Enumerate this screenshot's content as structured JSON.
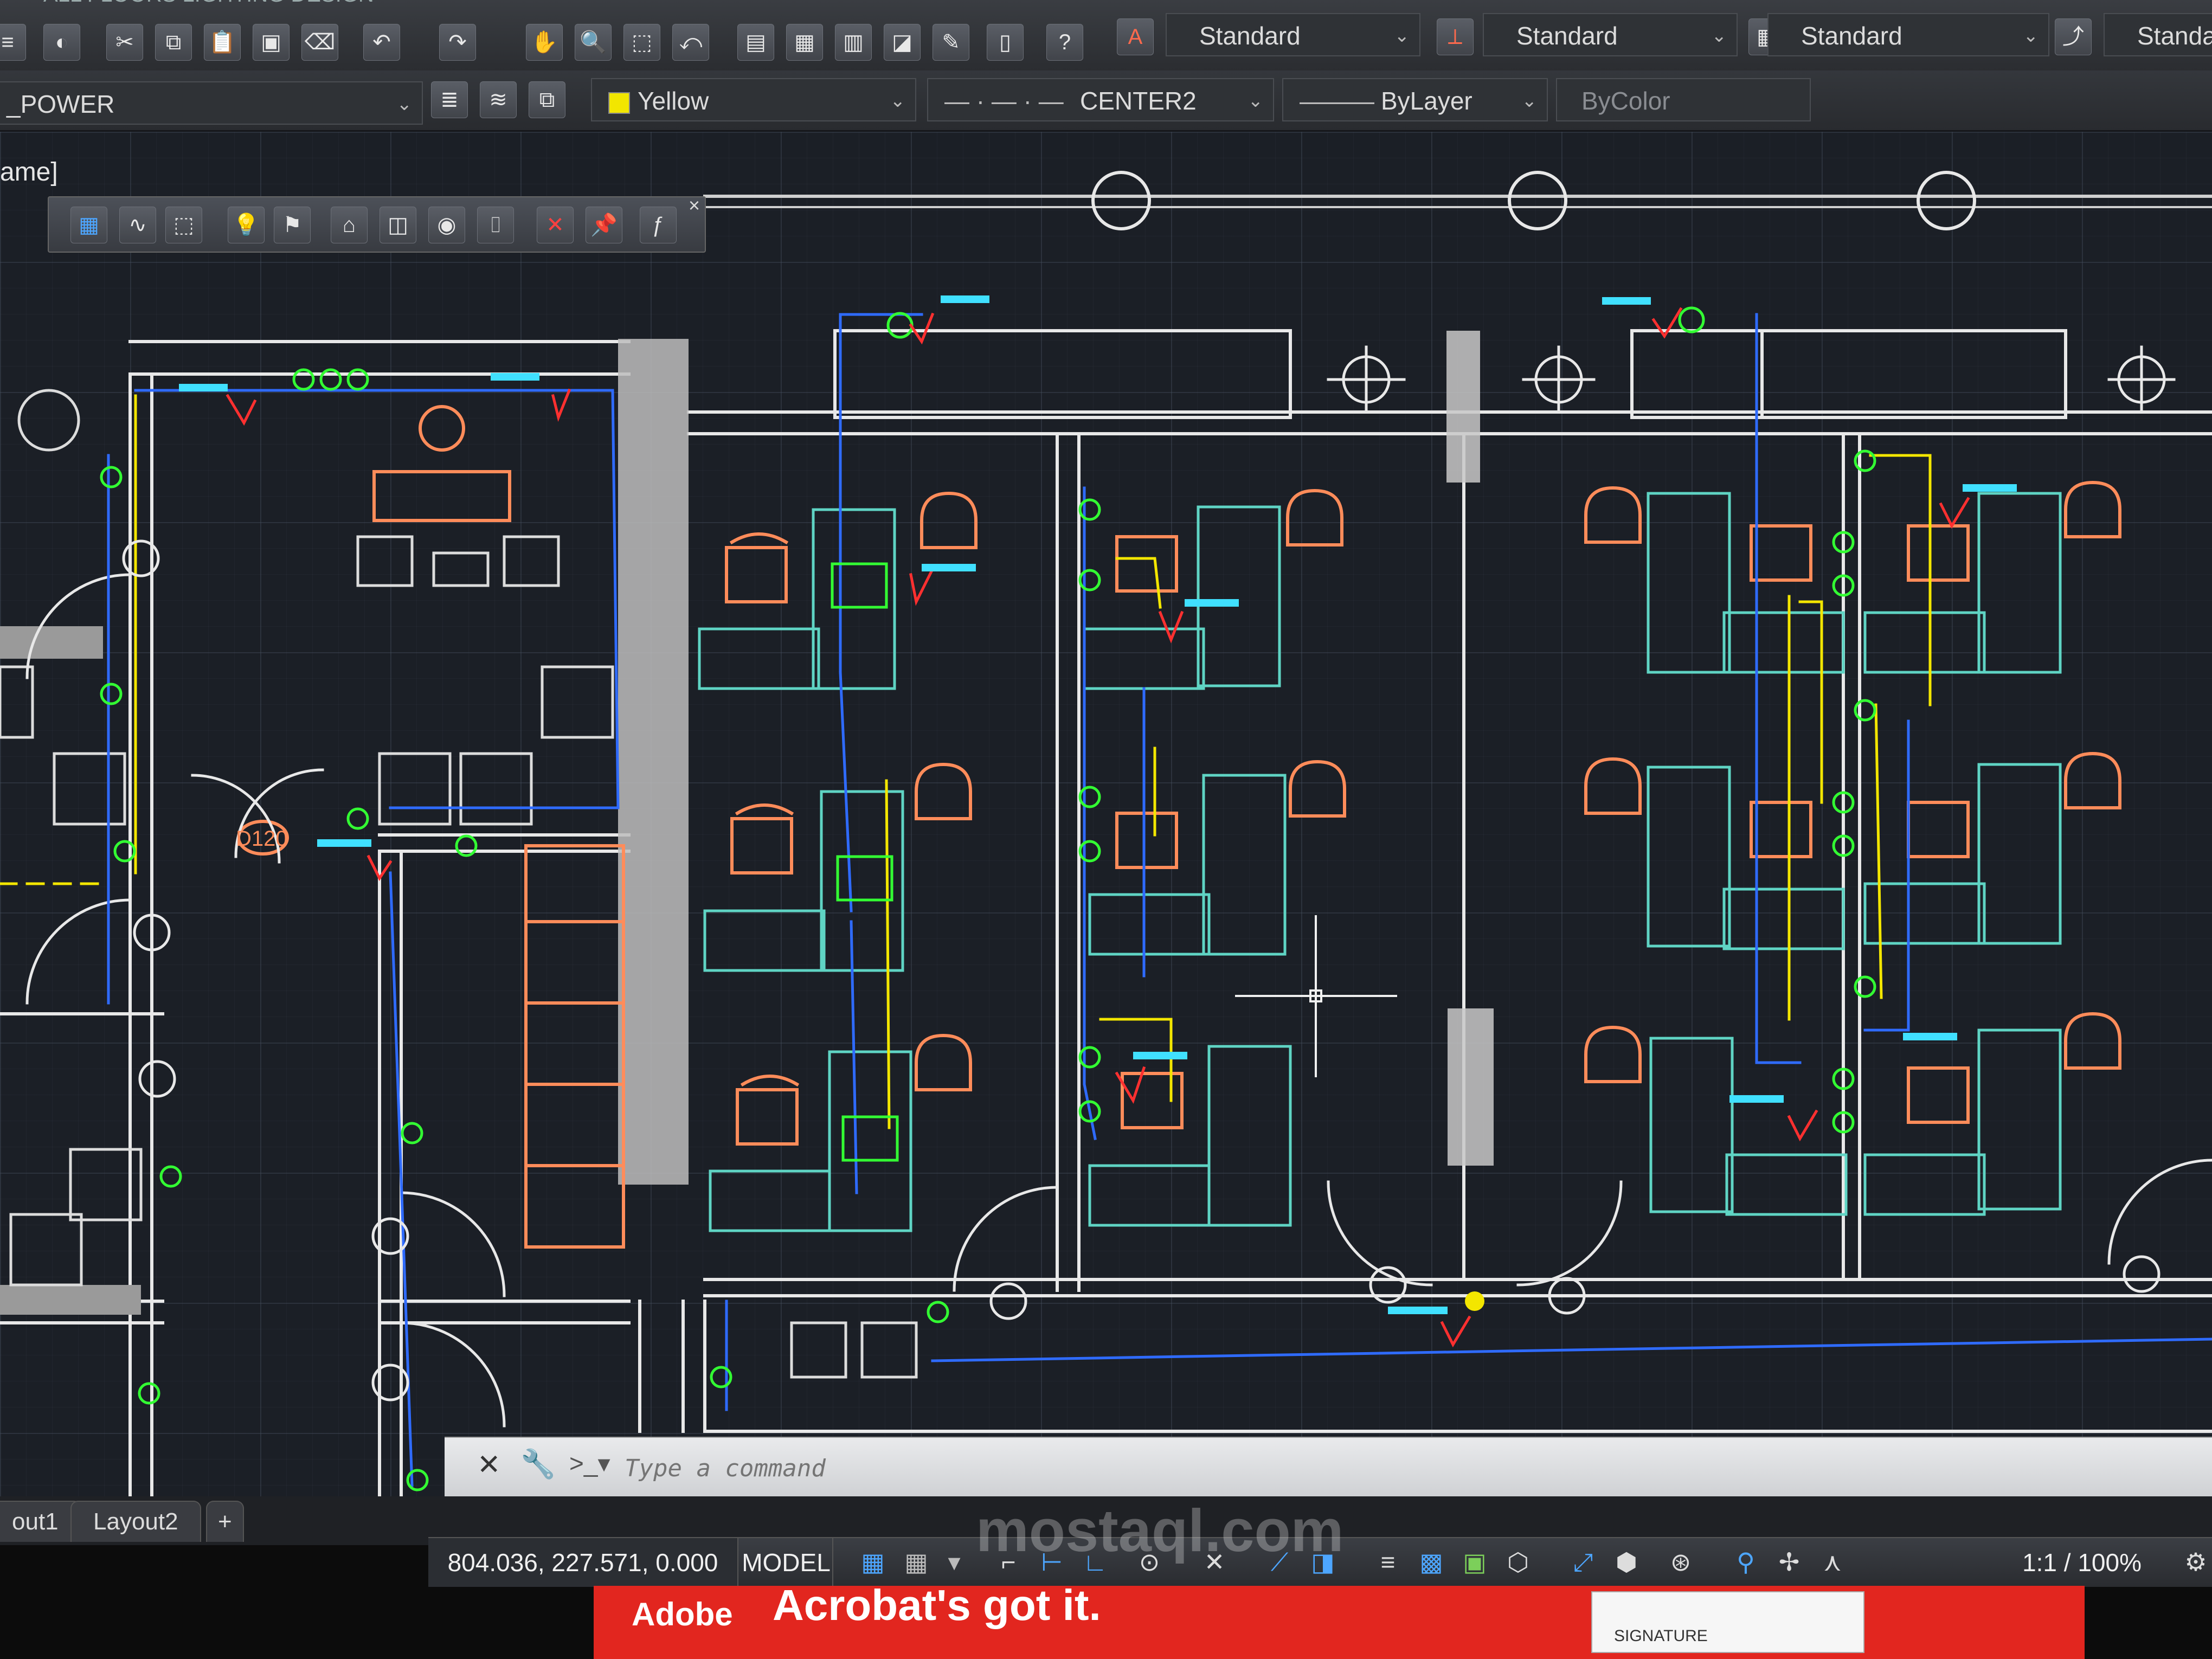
{
  "window_title": "ALL FLOORS LIGHTING DESIGN",
  "drawing_name_fragment": "ame]",
  "styles": {
    "text_style": "Standard",
    "dim_style": "Standard",
    "table_style": "Standard",
    "multileader_style": "Standa"
  },
  "layer": {
    "current": "_POWER",
    "color": "Yellow",
    "linetype": "CENTER2",
    "lineweight": "ByLayer",
    "plotstyle": "ByColor"
  },
  "colors": {
    "wall": "#e8e8e8",
    "circuit_blue": "#2f6bff",
    "circuit_yellow": "#f3e600",
    "fixture_green": "#33ff33",
    "furniture": "#ff8c5a",
    "desk": "#5fd4c4",
    "label_cyan": "#40e0ff",
    "red": "#ff3030"
  },
  "door_tag": "D120",
  "command": {
    "placeholder": "Type a command"
  },
  "layout_tabs": [
    "out1",
    "Layout2"
  ],
  "add_tab_label": "+",
  "status": {
    "coordinates": "804.036, 227.571, 0.000",
    "space": "MODEL",
    "scale": "1:1 / 100%"
  },
  "ad": {
    "brand": "Adobe",
    "slogan": "Acrobat's got it.",
    "signature_label": "SIGNATURE"
  },
  "watermark": "mostaql.com"
}
